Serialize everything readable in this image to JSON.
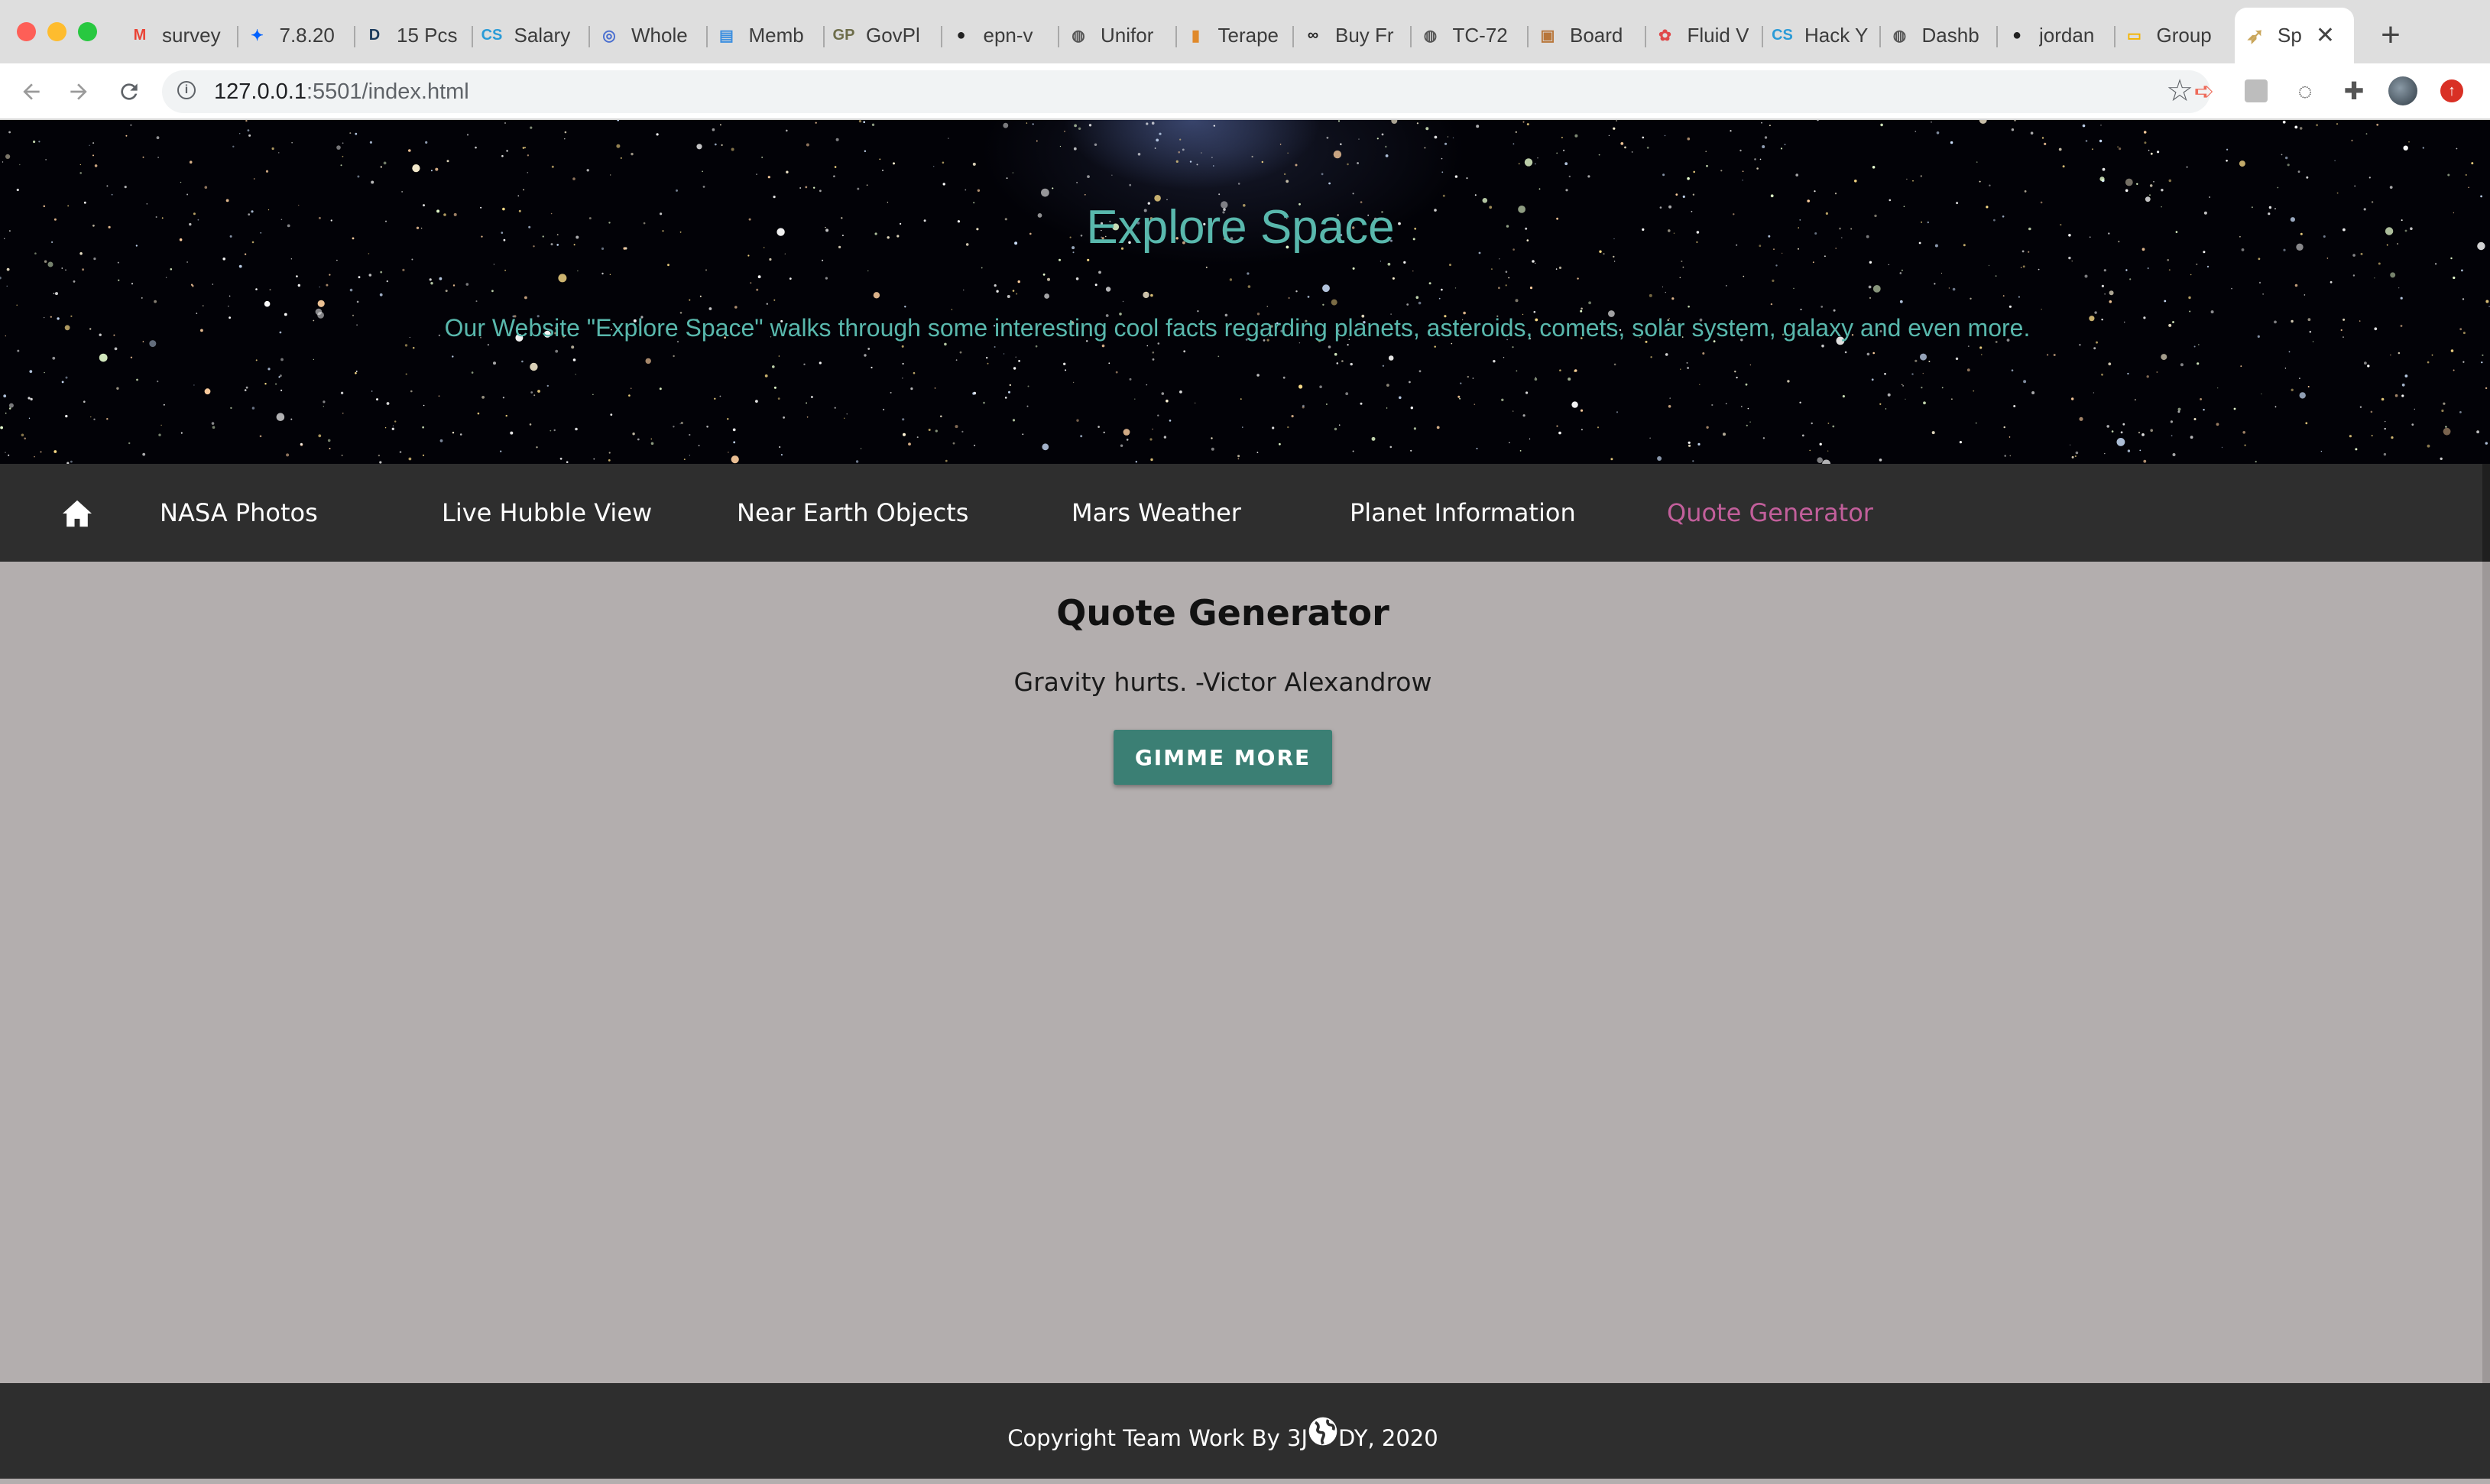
{
  "browser": {
    "tabs": [
      {
        "label": "survey",
        "icon": "gmail-icon",
        "glyph": "M",
        "color": "#ea4335"
      },
      {
        "label": "7.8.20",
        "icon": "dropbox-icon",
        "glyph": "✦",
        "color": "#0061fe"
      },
      {
        "label": "15 Pcs",
        "icon": "d-icon",
        "glyph": "D",
        "color": "#1b3a5c"
      },
      {
        "label": "Salary",
        "icon": "cs-icon",
        "glyph": "CS",
        "color": "#2a9bd7"
      },
      {
        "label": "Whole",
        "icon": "target-icon",
        "glyph": "◎",
        "color": "#4a6fd0"
      },
      {
        "label": "Memb",
        "icon": "doc-icon",
        "glyph": "▤",
        "color": "#3a8ee0"
      },
      {
        "label": "GovPl",
        "icon": "govpl-icon",
        "glyph": "GP",
        "color": "#6d6d4a"
      },
      {
        "label": "epn-v",
        "icon": "github-icon",
        "glyph": "●",
        "color": "#222222"
      },
      {
        "label": "Unifor",
        "icon": "globe-icon",
        "glyph": "◍",
        "color": "#555555"
      },
      {
        "label": "Terape",
        "icon": "bag-icon",
        "glyph": "▮",
        "color": "#e0892a"
      },
      {
        "label": "Buy Fr",
        "icon": "binoculars-icon",
        "glyph": "∞",
        "color": "#222222"
      },
      {
        "label": "TC-72",
        "icon": "globe-icon",
        "glyph": "◍",
        "color": "#555555"
      },
      {
        "label": "Board",
        "icon": "image-icon",
        "glyph": "▣",
        "color": "#b8763a"
      },
      {
        "label": "Fluid V",
        "icon": "fluid-icon",
        "glyph": "✿",
        "color": "#e0484a"
      },
      {
        "label": "Hack Y",
        "icon": "cs-icon",
        "glyph": "CS",
        "color": "#2a9bd7"
      },
      {
        "label": "Dashb",
        "icon": "globe-icon",
        "glyph": "◍",
        "color": "#555555"
      },
      {
        "label": "jordan",
        "icon": "github-icon",
        "glyph": "●",
        "color": "#222222"
      },
      {
        "label": "Group",
        "icon": "slides-icon",
        "glyph": "▭",
        "color": "#f4b400"
      }
    ],
    "active_tab": {
      "label": "Sp",
      "icon": "rocket-icon",
      "glyph": "➶",
      "color": "#c9a55a"
    },
    "url_host": "127.0.0.1",
    "url_rest": ":5501/index.html"
  },
  "hero": {
    "title": "Explore Space",
    "subtitle": "Our Website \"Explore Space\" walks through some interesting cool facts regarding planets, asteroids, comets, solar system, galaxy and even more."
  },
  "nav": {
    "items": [
      "NASA Photos",
      "Live Hubble View",
      "Near Earth Objects",
      "Mars Weather",
      "Planet Information",
      "Quote Generator"
    ],
    "active": "Quote Generator",
    "active_color": "#c25f9b"
  },
  "quote": {
    "title": "Quote Generator",
    "text": "Gravity hurts. -Victor Alexandrow",
    "button": "GIMME MORE"
  },
  "footer": {
    "before": "Copyright Team Work By 3J",
    "after": "DY, 2020"
  },
  "colors": {
    "accent": "#59b8ad",
    "navbar": "#2e2e2e",
    "content_bg": "#b3aeae",
    "button": "#3b7f74"
  }
}
